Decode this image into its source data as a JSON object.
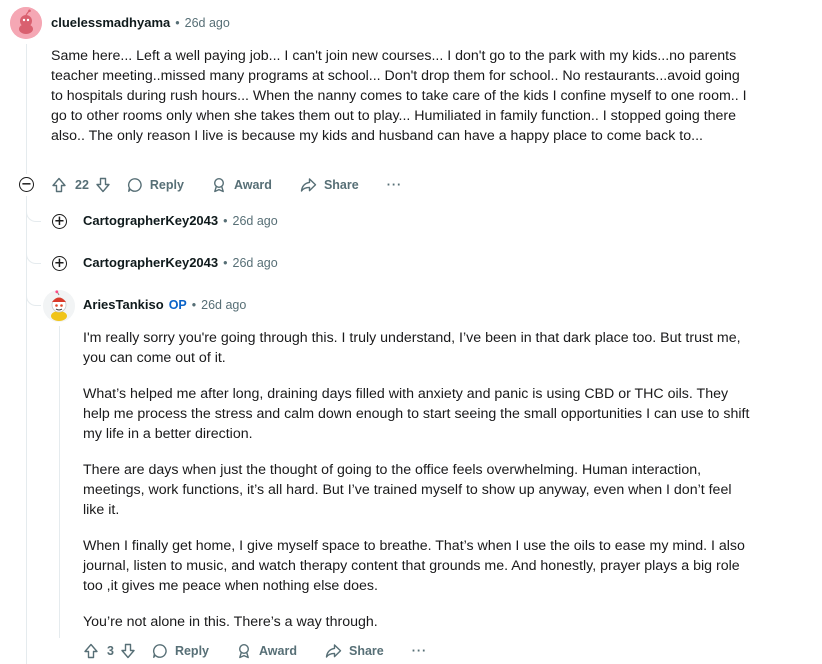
{
  "comment1": {
    "username": "cluelessmadhyama",
    "separator": "•",
    "time": "26d ago",
    "text": "Same here... Left a well paying job... I can't join new courses... I don't go to the park with my kids...no parents teacher meeting..missed many programs at school... Don't drop them for school.. No restaurants...avoid going to hospitals during rush hours... When the nanny comes to take care of the kids I confine myself to one room.. I go to other rooms only when she takes them out to play... Humiliated in family function.. I stopped going there also.. The only reason I live is because my kids and husband can have a happy place to come back to...",
    "vote_count": "22",
    "reply_label": "Reply",
    "award_label": "Award",
    "share_label": "Share",
    "more_label": "···",
    "collapse_symbol": "−"
  },
  "collapsed_replies": [
    {
      "username": "CartographerKey2043",
      "separator": "•",
      "time": "26d ago",
      "expand_symbol": "+"
    },
    {
      "username": "CartographerKey2043",
      "separator": "•",
      "time": "26d ago",
      "expand_symbol": "+"
    }
  ],
  "comment2": {
    "username": "AriesTankiso",
    "op_badge": "OP",
    "separator": "•",
    "time": "26d ago",
    "paragraphs": [
      "I'm really sorry you're going through this. I truly understand,  I’ve been in that dark place too. But trust me, you can come out of it.",
      "What’s helped me after long, draining days filled with anxiety and panic is using CBD or THC oils. They help me process the stress and calm down enough to start seeing the small opportunities I can use to shift my life in a better direction.",
      "There are days when just the thought of going to the office feels overwhelming. Human interaction, meetings, work functions, it’s all hard. But I’ve trained myself to show up anyway, even when I don’t feel like it.",
      "When I finally get home, I give myself space to breathe. That’s when I use the oils to ease my mind. I also journal, listen to music, and watch therapy content that grounds me. And honestly, prayer plays a big role too ,it gives me peace when nothing else does.",
      "You’re not alone in this. There’s a way through."
    ],
    "vote_count": "3",
    "reply_label": "Reply",
    "award_label": "Award",
    "share_label": "Share",
    "more_label": "···"
  },
  "colors": {
    "username": "#0f1a1c",
    "meta": "#576f76",
    "op": "#0a63c8",
    "thread_line": "#e5ebee",
    "avatar1_bg": "#f5a7b4"
  }
}
